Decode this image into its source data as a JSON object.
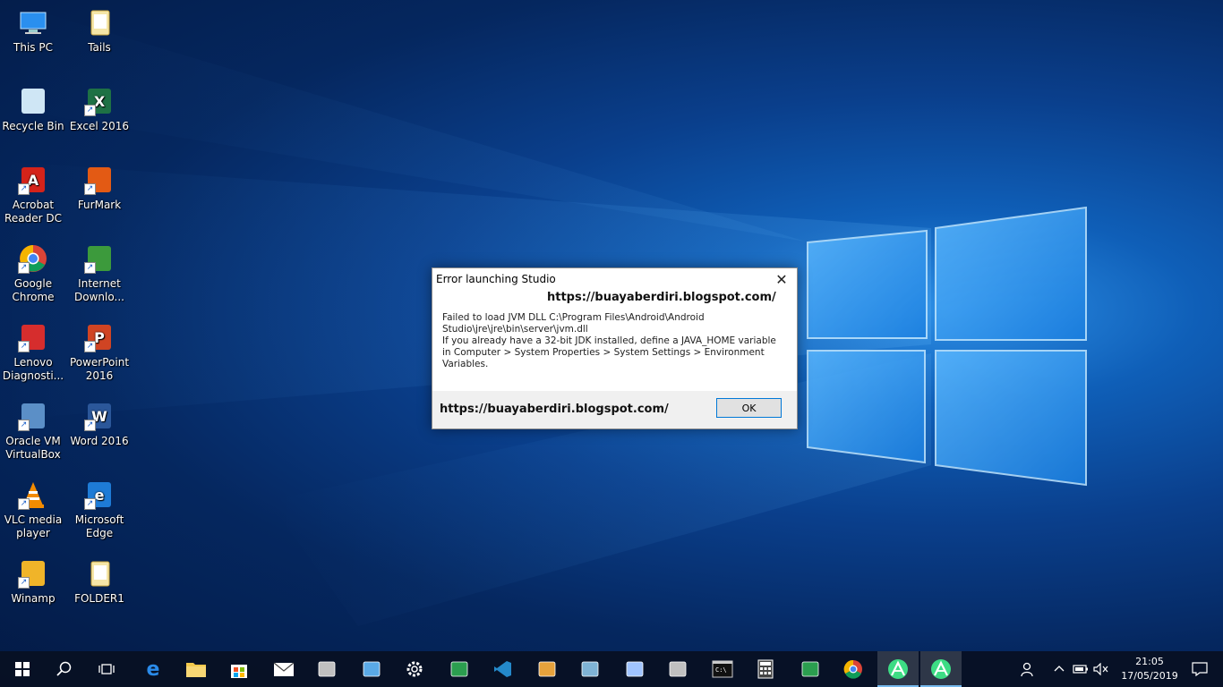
{
  "desktop": {
    "icons": [
      {
        "label": "This PC",
        "icon": "this-pc-icon"
      },
      {
        "label": "Tails",
        "icon": "folder-icon"
      },
      {
        "label": "Recycle Bin",
        "icon": "recycle-bin-icon"
      },
      {
        "label": "Excel 2016",
        "icon": "excel-icon"
      },
      {
        "label": "Acrobat Reader DC",
        "icon": "acrobat-icon"
      },
      {
        "label": "FurMark",
        "icon": "furmark-icon"
      },
      {
        "label": "Google Chrome",
        "icon": "chrome-icon"
      },
      {
        "label": "Internet Downlo...",
        "icon": "idm-icon"
      },
      {
        "label": "Lenovo Diagnosti...",
        "icon": "lenovo-diagnostics-icon"
      },
      {
        "label": "PowerPoint 2016",
        "icon": "powerpoint-icon"
      },
      {
        "label": "Oracle VM VirtualBox",
        "icon": "virtualbox-icon"
      },
      {
        "label": "Word 2016",
        "icon": "word-icon"
      },
      {
        "label": "VLC media player",
        "icon": "vlc-icon"
      },
      {
        "label": "Microsoft Edge",
        "icon": "edge-icon"
      },
      {
        "label": "Winamp",
        "icon": "winamp-icon"
      },
      {
        "label": "FOLDER1",
        "icon": "folder-icon"
      }
    ]
  },
  "dialog": {
    "title": "Error launching Studio",
    "close_label": "✕",
    "watermark_top": "https://buayaberdiri.blogspot.com/",
    "message_line1": "Failed to load JVM DLL C:\\Program Files\\Android\\Android Studio\\jre\\jre\\bin\\server\\jvm.dll",
    "message_line2": "If you already have a 32-bit JDK installed, define a JAVA_HOME variable in Computer > System Properties > System Settings > Environment Variables.",
    "watermark_bottom": "https://buayaberdiri.blogspot.com/",
    "ok_label": "OK"
  },
  "taskbar": {
    "pinned": [
      "start-icon",
      "search-icon",
      "task-view-icon",
      "edge-icon",
      "file-explorer-icon",
      "store-icon",
      "mail-icon",
      "network-tool-icon",
      "app-icon",
      "settings-icon",
      "paint-icon",
      "vscode-icon",
      "app-green-icon",
      "display-icon",
      "python-icon",
      "notepad-icon",
      "terminal-icon",
      "calculator-icon",
      "remote-desktop-icon",
      "chrome-icon",
      "android-studio-icon",
      "android-studio-icon"
    ],
    "clock_time": "21:05",
    "clock_date": "17/05/2019"
  }
}
